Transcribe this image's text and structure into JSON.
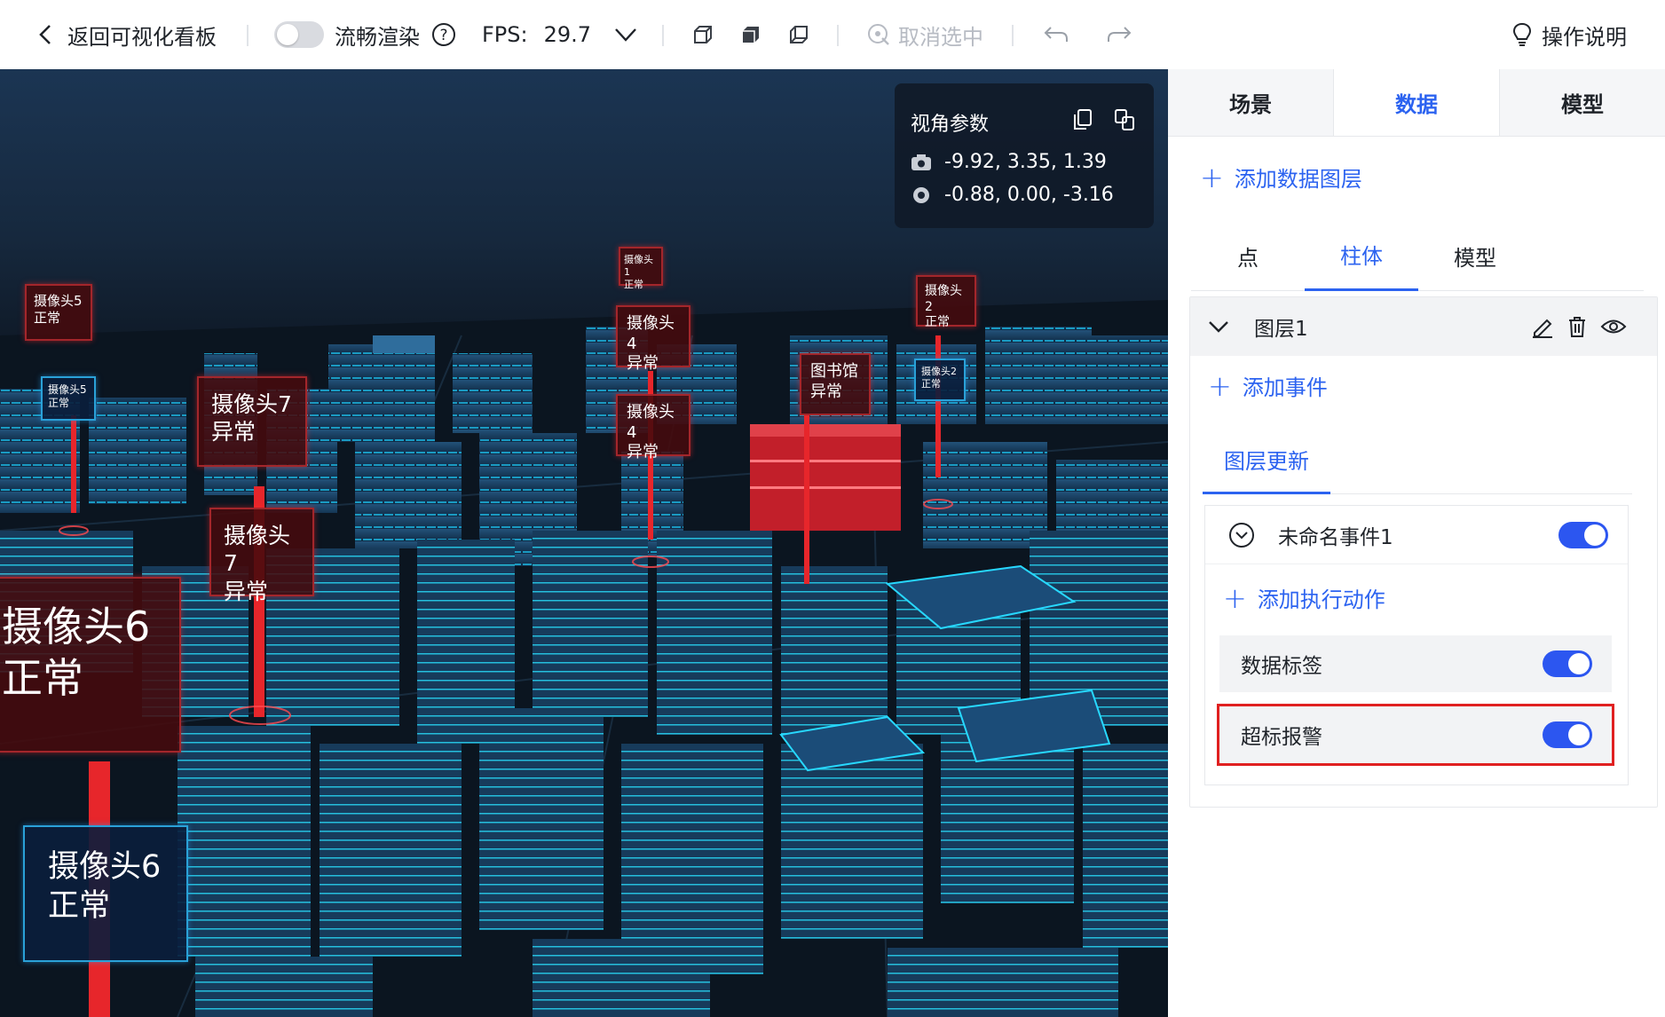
{
  "toolbar": {
    "back_label": "返回可视化看板",
    "smooth_render_label": "流畅渲染",
    "fps_label": "FPS:",
    "fps_value": "29.7",
    "cancel_select_label": "取消选中",
    "help_label": "操作说明"
  },
  "camera_panel": {
    "title": "视角参数",
    "camera_position": "-9.92, 3.35, 1.39",
    "target_position": "-0.88, 0.00, -3.16"
  },
  "markers": [
    {
      "name": "摄像头1",
      "status": "正常"
    },
    {
      "name": "摄像头5",
      "status": "正常"
    },
    {
      "name": "摄像头5",
      "status": "正常"
    },
    {
      "name": "摄像头4",
      "status": "异常"
    },
    {
      "name": "摄像头4",
      "status": "异常"
    },
    {
      "name": "图书馆",
      "status": "异常"
    },
    {
      "name": "摄像头2",
      "status": "正常"
    },
    {
      "name": "摄像头2",
      "status": "正常"
    },
    {
      "name": "摄像头7",
      "status": "异常"
    },
    {
      "name": "摄像头7",
      "status": "异常"
    },
    {
      "name": "摄像头6",
      "status": "正常"
    },
    {
      "name": "摄像头6",
      "status": "正常"
    }
  ],
  "right_panel": {
    "tabs": [
      "场景",
      "数据",
      "模型"
    ],
    "active_tab": "数据",
    "add_data_layer_label": "添加数据图层",
    "subtabs": [
      "点",
      "柱体",
      "模型"
    ],
    "active_subtab": "柱体",
    "layer": {
      "name": "图层1",
      "add_event_label": "添加事件",
      "update_tab_label": "图层更新",
      "event": {
        "name": "未命名事件1",
        "enabled": true,
        "add_action_label": "添加执行动作",
        "actions": [
          {
            "label": "数据标签",
            "enabled": true
          },
          {
            "label": "超标报警",
            "enabled": true
          }
        ]
      }
    }
  },
  "colors": {
    "accent": "#2c63f0",
    "toggle_on": "#2c56f0",
    "alarm_red": "#e02020",
    "building_cyan": "#19d6ff"
  }
}
